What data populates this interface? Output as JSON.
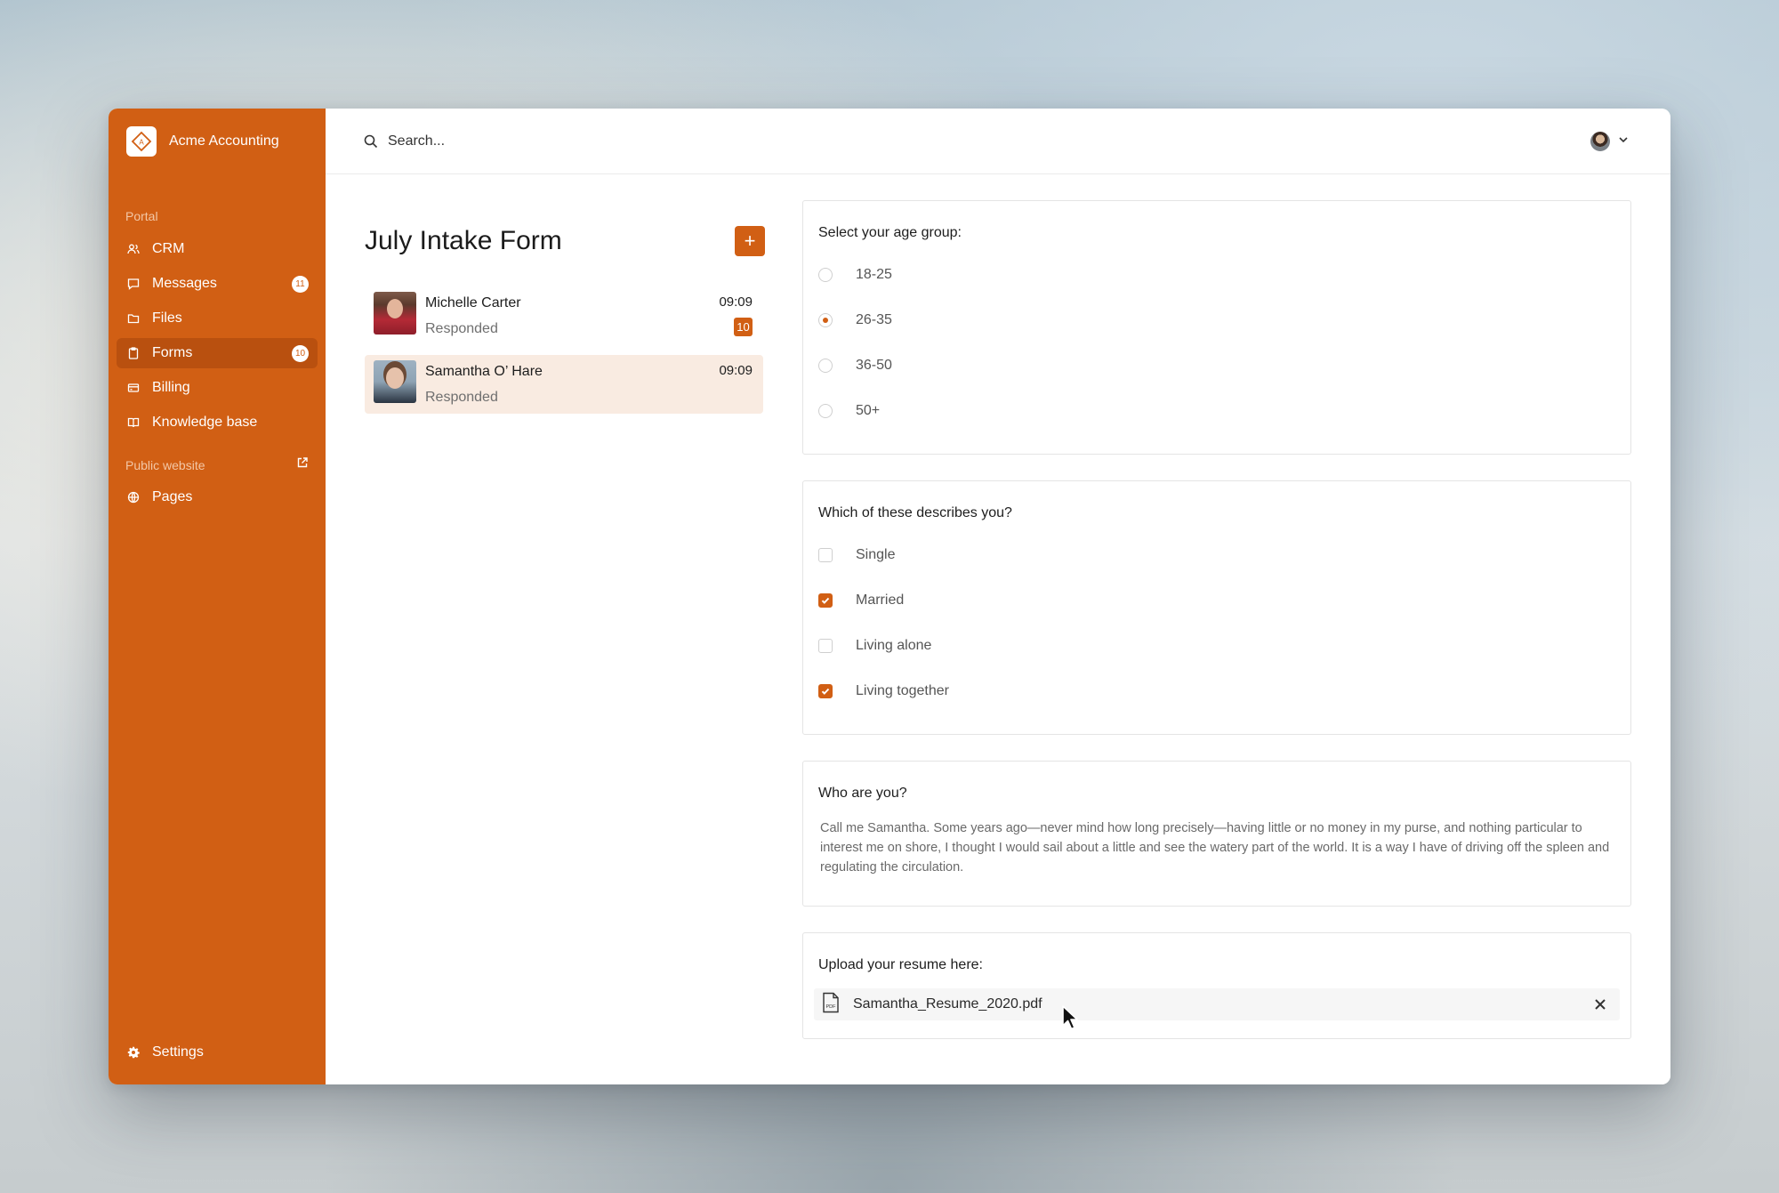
{
  "app": {
    "name": "Acme Accounting"
  },
  "sidebar": {
    "portal_label": "Portal",
    "items": [
      {
        "label": "CRM",
        "icon": "users-icon"
      },
      {
        "label": "Messages",
        "icon": "message-icon",
        "badge": "11"
      },
      {
        "label": "Files",
        "icon": "folder-icon"
      },
      {
        "label": "Forms",
        "icon": "clipboard-icon",
        "badge": "10",
        "active": true
      },
      {
        "label": "Billing",
        "icon": "credit-card-icon"
      },
      {
        "label": "Knowledge base",
        "icon": "book-icon"
      }
    ],
    "public_website_label": "Public website",
    "public_items": [
      {
        "label": "Pages",
        "icon": "globe-icon"
      }
    ],
    "settings_label": "Settings"
  },
  "search": {
    "placeholder": "Search..."
  },
  "form_list": {
    "title": "July Intake Form",
    "add_label": "+",
    "respondents": [
      {
        "name": "Michelle Carter",
        "status": "Responded",
        "time": "09:09",
        "badge": "10"
      },
      {
        "name": "Samantha O’ Hare",
        "status": "Responded",
        "time": "09:09",
        "selected": true
      }
    ]
  },
  "form": {
    "age_question": {
      "title": "Select your age group:",
      "options": [
        "18-25",
        "26-35",
        "36-50",
        "50+"
      ],
      "selected": "26-35"
    },
    "describe_question": {
      "title": "Which of these describes you?",
      "options": [
        {
          "label": "Single",
          "checked": false
        },
        {
          "label": "Married",
          "checked": true
        },
        {
          "label": "Living alone",
          "checked": false
        },
        {
          "label": "Living together",
          "checked": true
        }
      ]
    },
    "who_question": {
      "title": "Who are you?",
      "answer": "Call me Samantha. Some years ago—never mind how long precisely—having little or no money in my purse, and nothing particular to interest me on shore, I thought I would sail about a little and see the watery part of the world. It is a way I have of driving off the spleen and regulating the circulation."
    },
    "upload_question": {
      "title": "Upload your resume here:",
      "file_name": "Samantha_Resume_2020.pdf"
    }
  },
  "colors": {
    "accent": "#d15f14",
    "accent_dark": "#b9500f",
    "selected_row": "#f9ebe1"
  }
}
